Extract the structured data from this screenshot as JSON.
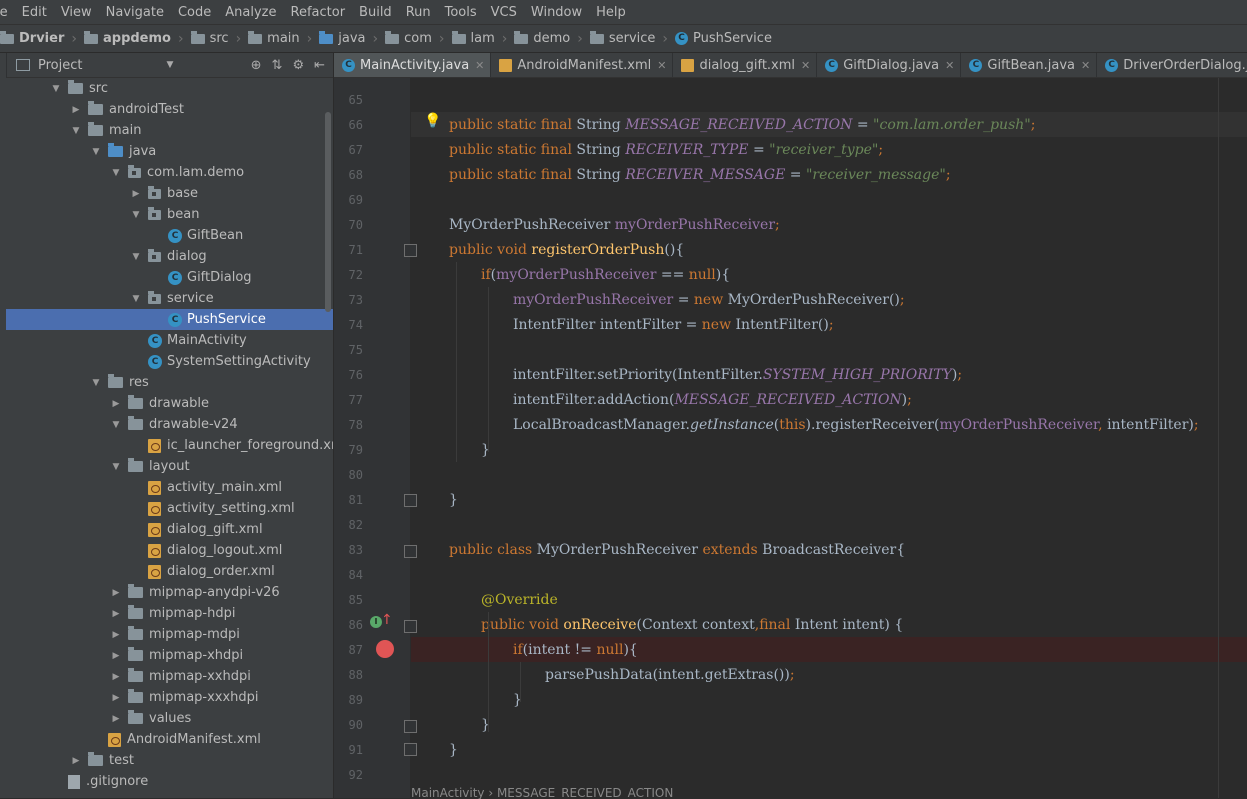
{
  "menu": [
    "le",
    "Edit",
    "View",
    "Navigate",
    "Code",
    "Analyze",
    "Refactor",
    "Build",
    "Run",
    "Tools",
    "VCS",
    "Window",
    "Help"
  ],
  "breadcrumb": {
    "project": "Drvier",
    "module": "appdemo",
    "src": "src",
    "main": "main",
    "java": "java",
    "com": "com",
    "lam": "lam",
    "demo": "demo",
    "service": "service",
    "file": "PushService"
  },
  "project_panel": {
    "title": "Project",
    "tree": [
      {
        "label": "src",
        "indent": 3,
        "arrow": "down",
        "icon": "folder"
      },
      {
        "label": "androidTest",
        "indent": 4,
        "arrow": "right",
        "icon": "folder"
      },
      {
        "label": "main",
        "indent": 4,
        "arrow": "down",
        "icon": "folder"
      },
      {
        "label": "java",
        "indent": 5,
        "arrow": "down",
        "icon": "folder-src"
      },
      {
        "label": "com.lam.demo",
        "indent": 6,
        "arrow": "down",
        "icon": "package"
      },
      {
        "label": "base",
        "indent": 7,
        "arrow": "right",
        "icon": "package"
      },
      {
        "label": "bean",
        "indent": 7,
        "arrow": "down",
        "icon": "package"
      },
      {
        "label": "GiftBean",
        "indent": 8,
        "arrow": "none",
        "icon": "class"
      },
      {
        "label": "dialog",
        "indent": 7,
        "arrow": "down",
        "icon": "package"
      },
      {
        "label": "GiftDialog",
        "indent": 8,
        "arrow": "none",
        "icon": "class"
      },
      {
        "label": "service",
        "indent": 7,
        "arrow": "down",
        "icon": "package"
      },
      {
        "label": "PushService",
        "indent": 8,
        "arrow": "none",
        "icon": "class",
        "selected": true
      },
      {
        "label": "MainActivity",
        "indent": 7,
        "arrow": "none",
        "icon": "class"
      },
      {
        "label": "SystemSettingActivity",
        "indent": 7,
        "arrow": "none",
        "icon": "class"
      },
      {
        "label": "res",
        "indent": 5,
        "arrow": "down",
        "icon": "folder-res"
      },
      {
        "label": "drawable",
        "indent": 6,
        "arrow": "right",
        "icon": "folder"
      },
      {
        "label": "drawable-v24",
        "indent": 6,
        "arrow": "down",
        "icon": "folder"
      },
      {
        "label": "ic_launcher_foreground.xml",
        "indent": 7,
        "arrow": "none",
        "icon": "xml"
      },
      {
        "label": "layout",
        "indent": 6,
        "arrow": "down",
        "icon": "folder"
      },
      {
        "label": "activity_main.xml",
        "indent": 7,
        "arrow": "none",
        "icon": "xml"
      },
      {
        "label": "activity_setting.xml",
        "indent": 7,
        "arrow": "none",
        "icon": "xml"
      },
      {
        "label": "dialog_gift.xml",
        "indent": 7,
        "arrow": "none",
        "icon": "xml"
      },
      {
        "label": "dialog_logout.xml",
        "indent": 7,
        "arrow": "none",
        "icon": "xml"
      },
      {
        "label": "dialog_order.xml",
        "indent": 7,
        "arrow": "none",
        "icon": "xml"
      },
      {
        "label": "mipmap-anydpi-v26",
        "indent": 6,
        "arrow": "right",
        "icon": "folder"
      },
      {
        "label": "mipmap-hdpi",
        "indent": 6,
        "arrow": "right",
        "icon": "folder"
      },
      {
        "label": "mipmap-mdpi",
        "indent": 6,
        "arrow": "right",
        "icon": "folder"
      },
      {
        "label": "mipmap-xhdpi",
        "indent": 6,
        "arrow": "right",
        "icon": "folder"
      },
      {
        "label": "mipmap-xxhdpi",
        "indent": 6,
        "arrow": "right",
        "icon": "folder"
      },
      {
        "label": "mipmap-xxxhdpi",
        "indent": 6,
        "arrow": "right",
        "icon": "folder"
      },
      {
        "label": "values",
        "indent": 6,
        "arrow": "right",
        "icon": "folder"
      },
      {
        "label": "AndroidManifest.xml",
        "indent": 5,
        "arrow": "none",
        "icon": "xml"
      },
      {
        "label": "test",
        "indent": 4,
        "arrow": "right",
        "icon": "folder"
      },
      {
        "label": ".gitignore",
        "indent": 3,
        "arrow": "none",
        "icon": "gitignore"
      }
    ]
  },
  "tabs": [
    {
      "label": "MainActivity.java",
      "type": "java",
      "active": true
    },
    {
      "label": "AndroidManifest.xml",
      "type": "xml"
    },
    {
      "label": "dialog_gift.xml",
      "type": "xml"
    },
    {
      "label": "GiftDialog.java",
      "type": "java"
    },
    {
      "label": "GiftBean.java",
      "type": "java"
    },
    {
      "label": "DriverOrderDialog.java",
      "type": "java"
    }
  ],
  "code_lines": [
    {
      "n": "65",
      "indent": 0,
      "parts": []
    },
    {
      "n": "66",
      "indent": 0,
      "parts": [
        [
          "k",
          "public static final "
        ],
        [
          "p",
          "String "
        ],
        [
          "c",
          "MESSAGE_RECEIVED_ACTION"
        ],
        [
          "p",
          " = "
        ],
        [
          "s",
          "\"com.lam.order_push\""
        ],
        [
          "k",
          ";"
        ]
      ]
    },
    {
      "n": "67",
      "indent": 0,
      "parts": [
        [
          "k",
          "public static final "
        ],
        [
          "p",
          "String "
        ],
        [
          "c",
          "RECEIVER_TYPE"
        ],
        [
          "p",
          " = "
        ],
        [
          "s",
          "\"receiver_type\""
        ],
        [
          "k",
          ";"
        ]
      ]
    },
    {
      "n": "68",
      "indent": 0,
      "parts": [
        [
          "k",
          "public static final "
        ],
        [
          "p",
          "String "
        ],
        [
          "c",
          "RECEIVER_MESSAGE"
        ],
        [
          "p",
          " = "
        ],
        [
          "s",
          "\"receiver_message\""
        ],
        [
          "k",
          ";"
        ]
      ]
    },
    {
      "n": "69",
      "indent": 0,
      "parts": []
    },
    {
      "n": "70",
      "indent": 0,
      "parts": [
        [
          "p",
          "MyOrderPushReceiver "
        ],
        [
          "f",
          "myOrderPushReceiver"
        ],
        [
          "k",
          ";"
        ]
      ]
    },
    {
      "n": "71",
      "indent": 0,
      "parts": [
        [
          "k",
          "public void "
        ],
        [
          "m",
          "registerOrderPush"
        ],
        [
          "p",
          "(){"
        ]
      ]
    },
    {
      "n": "72",
      "indent": 1,
      "parts": [
        [
          "k",
          "if"
        ],
        [
          "p",
          "("
        ],
        [
          "f",
          "myOrderPushReceiver"
        ],
        [
          "p",
          " == "
        ],
        [
          "k",
          "null"
        ],
        [
          "p",
          "){"
        ]
      ]
    },
    {
      "n": "73",
      "indent": 2,
      "parts": [
        [
          "f",
          "myOrderPushReceiver"
        ],
        [
          "p",
          " = "
        ],
        [
          "k",
          "new "
        ],
        [
          "p",
          "MyOrderPushReceiver()"
        ],
        [
          "k",
          ";"
        ]
      ]
    },
    {
      "n": "74",
      "indent": 2,
      "parts": [
        [
          "p",
          "IntentFilter intentFilter = "
        ],
        [
          "k",
          "new "
        ],
        [
          "p",
          "IntentFilter()"
        ],
        [
          "k",
          ";"
        ]
      ]
    },
    {
      "n": "75",
      "indent": 0,
      "parts": []
    },
    {
      "n": "76",
      "indent": 2,
      "parts": [
        [
          "p",
          "intentFilter.setPriority(IntentFilter."
        ],
        [
          "c",
          "SYSTEM_HIGH_PRIORITY"
        ],
        [
          "p",
          ")"
        ],
        [
          "k",
          ";"
        ]
      ]
    },
    {
      "n": "77",
      "indent": 2,
      "parts": [
        [
          "p",
          "intentFilter.addAction("
        ],
        [
          "c",
          "MESSAGE_RECEIVED_ACTION"
        ],
        [
          "p",
          ")"
        ],
        [
          "k",
          ";"
        ]
      ]
    },
    {
      "n": "78",
      "indent": 2,
      "parts": [
        [
          "p",
          "LocalBroadcastManager."
        ],
        [
          "i",
          "getInstance"
        ],
        [
          "p",
          "("
        ],
        [
          "k",
          "this"
        ],
        [
          "p",
          ").registerReceiver("
        ],
        [
          "f",
          "myOrderPushReceiver"
        ],
        [
          "k",
          ", "
        ],
        [
          "p",
          "intentFilter)"
        ],
        [
          "k",
          ";"
        ]
      ]
    },
    {
      "n": "79",
      "indent": 1,
      "parts": [
        [
          "p",
          "}"
        ]
      ]
    },
    {
      "n": "80",
      "indent": 0,
      "parts": []
    },
    {
      "n": "81",
      "indent": 0,
      "parts": [
        [
          "p",
          "}"
        ]
      ]
    },
    {
      "n": "82",
      "indent": 0,
      "parts": []
    },
    {
      "n": "83",
      "indent": 0,
      "parts": [
        [
          "k",
          "public class "
        ],
        [
          "p",
          "MyOrderPushReceiver "
        ],
        [
          "k",
          "extends "
        ],
        [
          "p",
          "BroadcastReceiver{"
        ]
      ]
    },
    {
      "n": "84",
      "indent": 0,
      "parts": []
    },
    {
      "n": "85",
      "indent": 1,
      "parts": [
        [
          "a",
          "@Override"
        ]
      ]
    },
    {
      "n": "86",
      "indent": 1,
      "parts": [
        [
          "k",
          "public void "
        ],
        [
          "m",
          "onReceive"
        ],
        [
          "p",
          "(Context context"
        ],
        [
          "k",
          ","
        ],
        [
          "k",
          "final "
        ],
        [
          "p",
          "Intent intent) {"
        ]
      ]
    },
    {
      "n": "87",
      "indent": 2,
      "parts": [
        [
          "k",
          "if"
        ],
        [
          "p",
          "(intent != "
        ],
        [
          "k",
          "null"
        ],
        [
          "p",
          "){"
        ]
      ]
    },
    {
      "n": "88",
      "indent": 3,
      "parts": [
        [
          "p",
          "parsePushData(intent.getExtras())"
        ],
        [
          "k",
          ";"
        ]
      ]
    },
    {
      "n": "89",
      "indent": 2,
      "parts": [
        [
          "p",
          "}"
        ]
      ]
    },
    {
      "n": "90",
      "indent": 1,
      "parts": [
        [
          "p",
          "}"
        ]
      ]
    },
    {
      "n": "91",
      "indent": 0,
      "parts": [
        [
          "p",
          "}"
        ]
      ]
    },
    {
      "n": "92",
      "indent": 0,
      "parts": []
    }
  ],
  "status_breadcrumb": "MainActivity  ›  MESSAGE_RECEIVED_ACTION"
}
